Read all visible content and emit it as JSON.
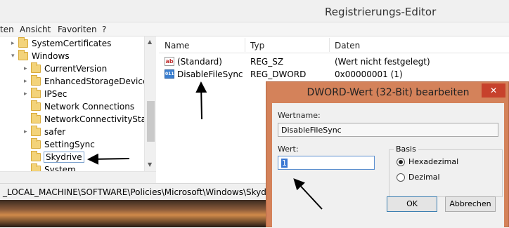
{
  "window": {
    "title": "Registrierungs-Editor"
  },
  "menu": [
    "ten",
    "Ansicht",
    "Favoriten",
    "?"
  ],
  "tree": {
    "items": [
      {
        "label": "SystemCertificates",
        "chevron": "▸"
      },
      {
        "label": "Windows",
        "chevron": "▾"
      },
      {
        "label": "CurrentVersion",
        "chevron": "▸"
      },
      {
        "label": "EnhancedStorageDevices",
        "chevron": "▸"
      },
      {
        "label": "IPSec",
        "chevron": "▸"
      },
      {
        "label": "Network Connections",
        "chevron": ""
      },
      {
        "label": "NetworkConnectivityStatu",
        "chevron": ""
      },
      {
        "label": "safer",
        "chevron": "▸"
      },
      {
        "label": "SettingSync",
        "chevron": ""
      },
      {
        "label": "Skydrive",
        "chevron": ""
      },
      {
        "label": "System",
        "chevron": ""
      }
    ],
    "selected": "Skydrive"
  },
  "list": {
    "columns": [
      "Name",
      "Typ",
      "Daten"
    ],
    "rows": [
      {
        "icon": "string-value-icon",
        "icon_text": "ab",
        "name": "(Standard)",
        "type": "REG_SZ",
        "data": "(Wert nicht festgelegt)"
      },
      {
        "icon": "dword-value-icon",
        "icon_text": "011",
        "name": "DisableFileSync",
        "type": "REG_DWORD",
        "data": "0x00000001 (1)"
      }
    ]
  },
  "status": {
    "path": "_LOCAL_MACHINE\\SOFTWARE\\Policies\\Microsoft\\Windows\\Skydrive"
  },
  "dialog": {
    "title": "DWORD-Wert (32-Bit) bearbeiten",
    "close": "✕",
    "wertname_label": "Wertname:",
    "wertname_value": "DisableFileSync",
    "wert_label": "Wert:",
    "wert_value": "1",
    "basis_label": "Basis",
    "basis_options": [
      {
        "label": "Hexadezimal",
        "selected": true
      },
      {
        "label": "Dezimal",
        "selected": false
      }
    ],
    "ok": "OK",
    "cancel": "Abbrechen"
  },
  "colors": {
    "dialog_frame": "#d4825a",
    "close_button": "#c7412c",
    "selection": "#3a78d3"
  }
}
